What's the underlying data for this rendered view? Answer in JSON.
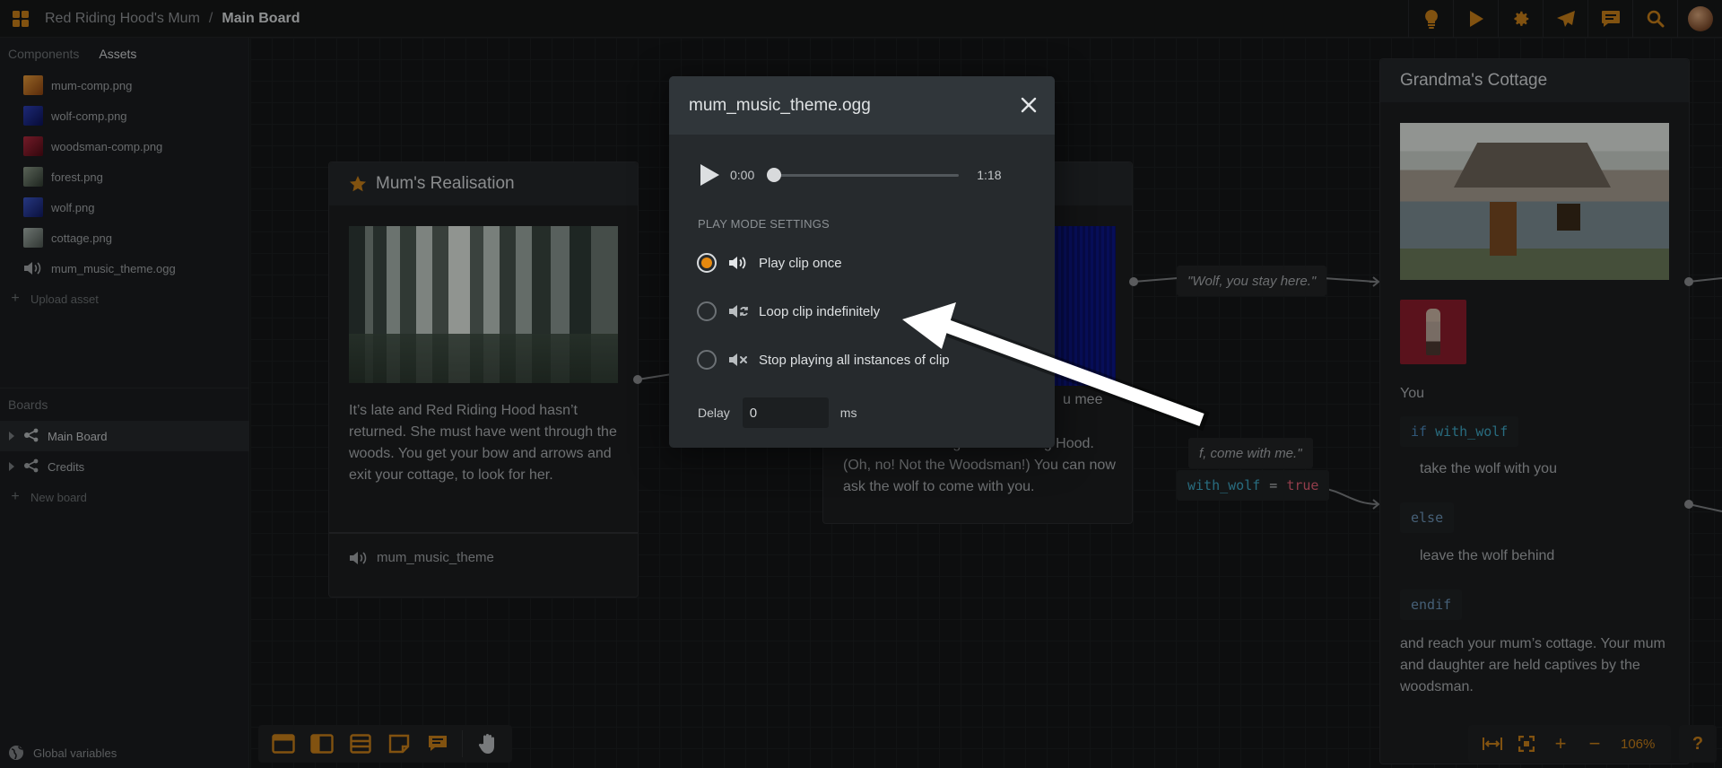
{
  "header": {
    "project": "Red Riding Hood's Mum",
    "separator": "/",
    "board": "Main Board"
  },
  "left_panel": {
    "tabs": [
      {
        "label": "Components",
        "active": false
      },
      {
        "label": "Assets",
        "active": true
      }
    ],
    "assets": [
      {
        "name": "mum-comp.png",
        "color": "#c46a14"
      },
      {
        "name": "wolf-comp.png",
        "color": "#1b2b8e"
      },
      {
        "name": "woodsman-comp.png",
        "color": "#8f1b2a"
      },
      {
        "name": "forest.png",
        "color": "#5c6a5a"
      },
      {
        "name": "wolf.png",
        "color": "#2a3d8f"
      },
      {
        "name": "cottage.png",
        "color": "#7f8a86"
      },
      {
        "name": "mum_music_theme.ogg",
        "type": "audio"
      }
    ],
    "upload_label": "Upload asset",
    "boards_title": "Boards",
    "boards": [
      {
        "label": "Main Board",
        "active": true
      },
      {
        "label": "Credits",
        "active": false
      }
    ],
    "new_board_label": "New board",
    "global_vars_label": "Global variables"
  },
  "cards": {
    "mum": {
      "title": "Mum's Realisation",
      "text": "It’s late and Red Riding Hood hasn’t returned. She must have went through the woods. You get your bow and arrows and exit your cottage, to look for her.",
      "audio_label": "mum_music_theme"
    },
    "middle": {
      "text_fragment_1": "u mee",
      "text": "Woodsman talking to Red Riding Hood. (Oh, no! Not the Woodsman!) You can now ask the wolf to come with you."
    },
    "grandma": {
      "title": "Grandma's Cottage",
      "you": "You",
      "if_kw": "if",
      "if_var": "with_wolf",
      "take_text": "take the wolf with you",
      "else_kw": "else",
      "leave_text": "leave the wolf behind",
      "endif_kw": "endif",
      "ending": "and reach your mum’s cottage. Your mum and daughter are held captives by the woodsman."
    }
  },
  "edges": {
    "label_stay": "\"Wolf, you stay here.\"",
    "label_come": "f, come with me.\"",
    "assign_var": "with_wolf",
    "assign_op": "=",
    "assign_val": "true"
  },
  "zoom": {
    "value": "106%"
  },
  "dialog": {
    "title": "mum_music_theme.ogg",
    "time_current": "0:00",
    "time_total": "1:18",
    "progress": 0,
    "settings_title": "PLAY MODE SETTINGS",
    "options": [
      {
        "label": "Play clip once",
        "selected": true
      },
      {
        "label": "Loop clip indefinitely",
        "selected": false
      },
      {
        "label": "Stop playing all instances of clip",
        "selected": false
      }
    ],
    "delay_label": "Delay",
    "delay_value": "0",
    "delay_unit": "ms"
  },
  "colors": {
    "accent": "#e6890f",
    "icon_orange": "#c77f19"
  }
}
